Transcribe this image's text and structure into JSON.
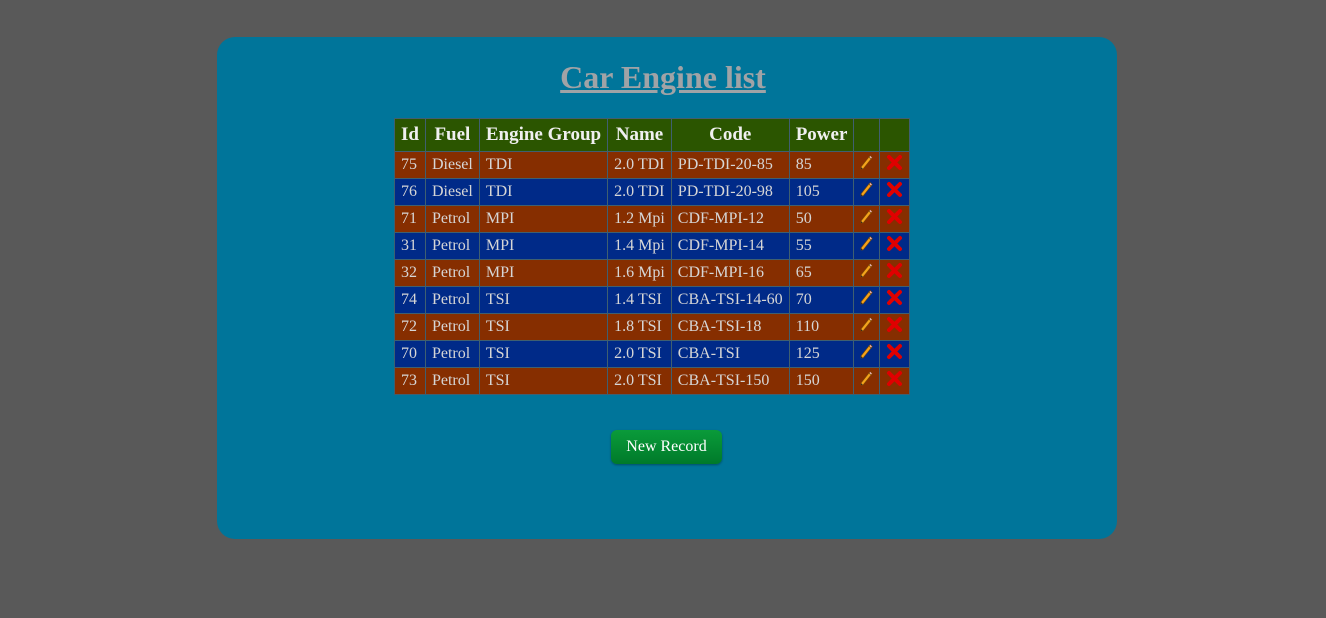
{
  "page": {
    "title": "Car Engine list"
  },
  "table": {
    "columns": [
      "Id",
      "Fuel",
      "Engine Group",
      "Name",
      "Code",
      "Power",
      "",
      ""
    ],
    "rows": [
      {
        "id": "75",
        "fuel": "Diesel",
        "group": "TDI",
        "name": "2.0 TDI",
        "code": "PD-TDI-20-85",
        "power": "85"
      },
      {
        "id": "76",
        "fuel": "Diesel",
        "group": "TDI",
        "name": "2.0 TDI",
        "code": "PD-TDI-20-98",
        "power": "105"
      },
      {
        "id": "71",
        "fuel": "Petrol",
        "group": "MPI",
        "name": "1.2 Mpi",
        "code": "CDF-MPI-12",
        "power": "50"
      },
      {
        "id": "31",
        "fuel": "Petrol",
        "group": "MPI",
        "name": "1.4 Mpi",
        "code": "CDF-MPI-14",
        "power": "55"
      },
      {
        "id": "32",
        "fuel": "Petrol",
        "group": "MPI",
        "name": "1.6 Mpi",
        "code": "CDF-MPI-16",
        "power": "65"
      },
      {
        "id": "74",
        "fuel": "Petrol",
        "group": "TSI",
        "name": "1.4 TSI",
        "code": "CBA-TSI-14-60",
        "power": "70"
      },
      {
        "id": "72",
        "fuel": "Petrol",
        "group": "TSI",
        "name": "1.8 TSI",
        "code": "CBA-TSI-18",
        "power": "110"
      },
      {
        "id": "70",
        "fuel": "Petrol",
        "group": "TSI",
        "name": "2.0 TSI",
        "code": "CBA-TSI",
        "power": "125"
      },
      {
        "id": "73",
        "fuel": "Petrol",
        "group": "TSI",
        "name": "2.0 TSI",
        "code": "CBA-TSI-150",
        "power": "150"
      }
    ],
    "row_icons": {
      "edit": "pencil-icon",
      "delete": "red-x-icon"
    }
  },
  "actions": {
    "new_record_label": "New Record"
  },
  "colors": {
    "background": "#595959",
    "panel": "#00759a",
    "header": "#2b5500",
    "row_odd": "#862e00",
    "row_even": "#002a88",
    "button": "#008a32",
    "delete": "#e00000"
  }
}
